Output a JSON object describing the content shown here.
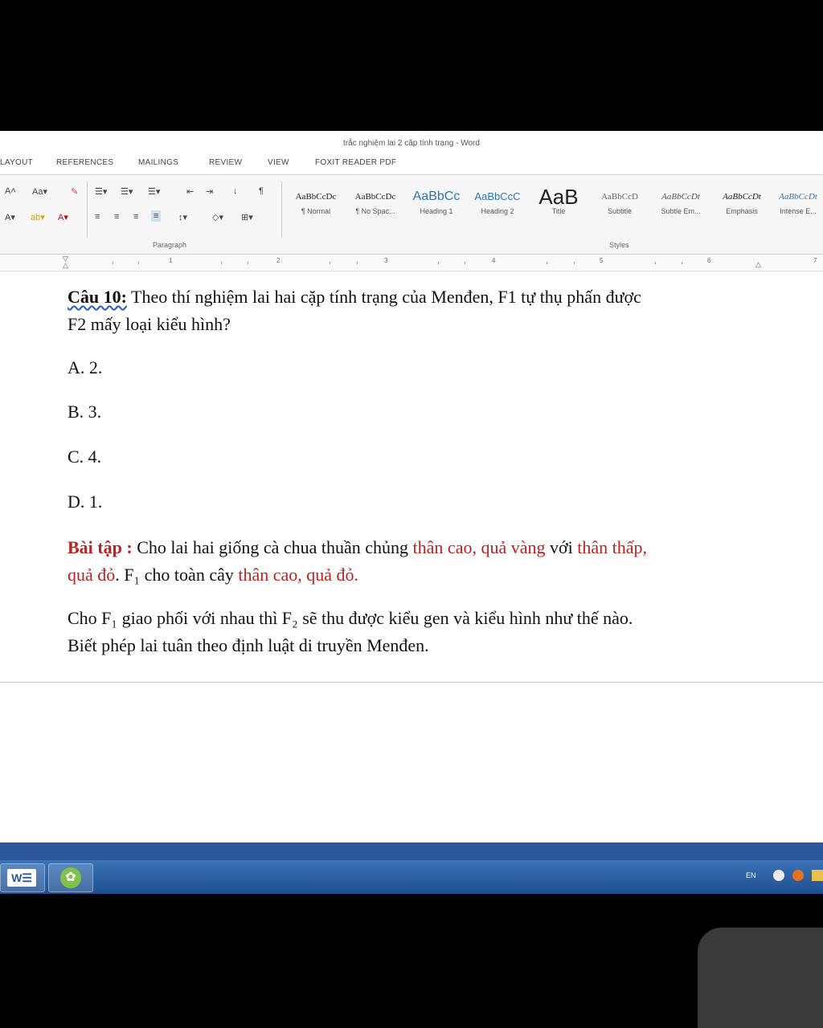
{
  "window": {
    "title": "trắc nghiệm lai 2 cặp tính trạng - Word"
  },
  "tabs": [
    "LAYOUT",
    "REFERENCES",
    "MAILINGS",
    "REVIEW",
    "VIEW",
    "FOXIT READER PDF"
  ],
  "ribbon": {
    "groups": {
      "paragraph": "Paragraph",
      "styles": "Styles"
    },
    "styles": [
      {
        "sample": "AaBbCcDc",
        "name": "¶ Normal"
      },
      {
        "sample": "AaBbCcDc",
        "name": "¶ No Spac..."
      },
      {
        "sample": "AaBbCc",
        "name": "Heading 1"
      },
      {
        "sample": "AaBbCcC",
        "name": "Heading 2"
      },
      {
        "sample": "AaB",
        "name": "Title"
      },
      {
        "sample": "AaBbCcD",
        "name": "Subtitle"
      },
      {
        "sample": "AaBbCcDt",
        "name": "Subtle Em..."
      },
      {
        "sample": "AaBbCcDt",
        "name": "Emphasis"
      },
      {
        "sample": "AaBbCcDt",
        "name": "Intense E..."
      }
    ]
  },
  "ruler": {
    "numbers": [
      "1",
      "2",
      "3",
      "4",
      "5",
      "6",
      "7"
    ]
  },
  "document": {
    "q_label": "Câu 10:",
    "q_text_1": " Theo thí nghiệm lai hai cặp tính trạng của Menđen, F1 tự thụ phấn được",
    "q_text_2": "F2 mấy loại kiểu hình?",
    "options": [
      "A. 2.",
      "B. 3.",
      "C. 4.",
      "D. 1."
    ],
    "ex_label": "Bài tập :",
    "ex_text_1": " Cho lai hai giống cà chua thuần chủng ",
    "ex_red_1": "thân cao, quả vàng",
    "ex_text_2": " với ",
    "ex_red_2": "thân thấp,",
    "ex_red_3": "quả đỏ",
    "ex_text_3": ". F₁ cho toàn cây ",
    "ex_red_4": "thân cao, quả đỏ",
    "ex_text_4": ".",
    "p2_line1": "Cho F₁ giao phối với nhau thì F₂ sẽ thu được kiểu gen và kiểu hình như thế nào.",
    "p2_line2": "Biết phép lai tuân theo định luật di truyền Menđen."
  },
  "taskbar": {
    "tray_lang": "EN"
  },
  "colors": {
    "accent": "#2b579a",
    "red_text": "#c02020",
    "taskbar": "#2f65a8"
  }
}
